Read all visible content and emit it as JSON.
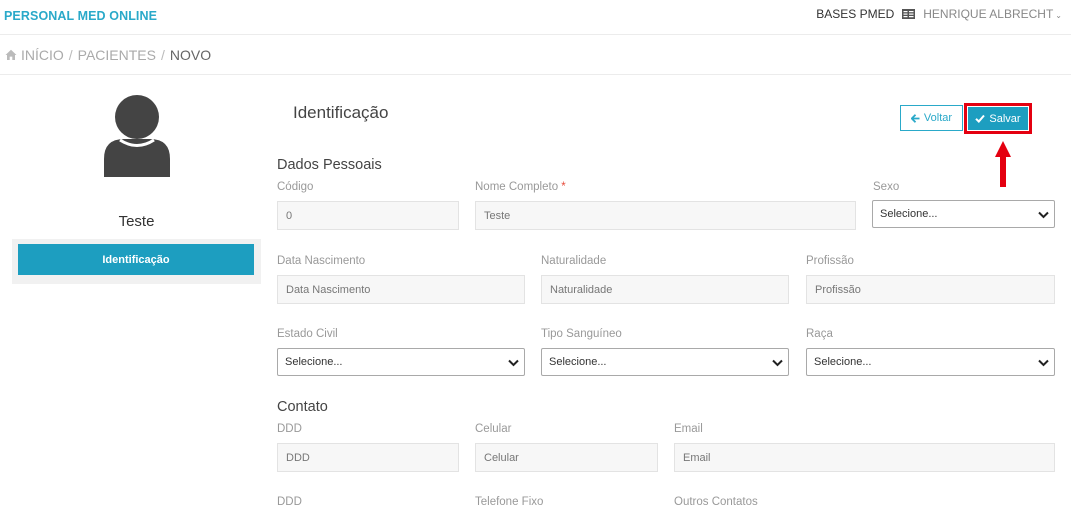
{
  "header": {
    "brand": "PERSONAL MED ONLINE",
    "bases": "BASES PMED",
    "user": "HENRIQUE ALBRECHT"
  },
  "breadcrumb": {
    "items": [
      "INÍCIO",
      "PACIENTES",
      "NOVO"
    ],
    "separator": "/"
  },
  "sidebar": {
    "patient_name": "Teste",
    "tab_label": "Identificação"
  },
  "main": {
    "title": "Identificação",
    "voltar_label": "Voltar",
    "salvar_label": "Salvar"
  },
  "dados_pessoais": {
    "title": "Dados Pessoais",
    "codigo": {
      "label": "Código",
      "value": "0"
    },
    "nome": {
      "label": "Nome Completo",
      "required_mark": "*",
      "value": "Teste"
    },
    "sexo": {
      "label": "Sexo",
      "value": "Selecione..."
    },
    "data_nascimento": {
      "label": "Data Nascimento",
      "placeholder": "Data Nascimento"
    },
    "naturalidade": {
      "label": "Naturalidade",
      "placeholder": "Naturalidade"
    },
    "profissao": {
      "label": "Profissão",
      "placeholder": "Profissão"
    },
    "estado_civil": {
      "label": "Estado Civil",
      "value": "Selecione..."
    },
    "tipo_sanguineo": {
      "label": "Tipo Sanguíneo",
      "value": "Selecione..."
    },
    "raca": {
      "label": "Raça",
      "value": "Selecione..."
    }
  },
  "contato": {
    "title": "Contato",
    "ddd1": {
      "label": "DDD",
      "placeholder": "DDD"
    },
    "celular": {
      "label": "Celular",
      "placeholder": "Celular"
    },
    "email": {
      "label": "Email",
      "placeholder": "Email"
    },
    "ddd2": {
      "label": "DDD"
    },
    "telefone_fixo": {
      "label": "Telefone Fixo"
    },
    "outros_contatos": {
      "label": "Outros Contatos"
    }
  },
  "colors": {
    "brand": "#2aa9c9",
    "primary": "#1d9ec0",
    "highlight": "#e40010"
  },
  "icons": [
    "home-icon",
    "database-icon",
    "chevron-down-icon",
    "arrow-left-icon",
    "check-icon",
    "user-avatar-icon",
    "red-arrow-annotation"
  ]
}
